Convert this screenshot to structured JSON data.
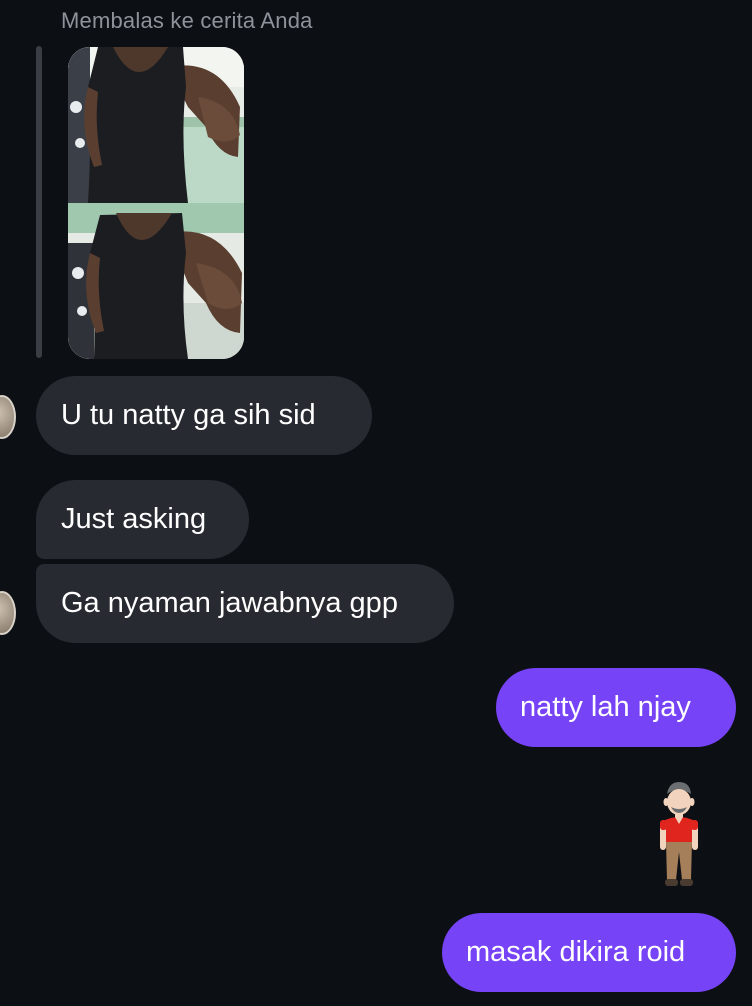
{
  "thread": {
    "reply_context": "Membalas ke cerita Anda",
    "story_image_alt": "Story photo: man in black tank top flexing, two frames"
  },
  "messages": [
    {
      "direction": "incoming",
      "text": "U tu natty ga sih sid"
    },
    {
      "direction": "incoming",
      "text": "Just asking"
    },
    {
      "direction": "incoming",
      "text": "Ga nyaman jawabnya gpp"
    },
    {
      "direction": "outgoing",
      "text": "natty lah njay"
    },
    {
      "direction": "outgoing",
      "emoji": "man-standing-emoji"
    },
    {
      "direction": "outgoing",
      "text": "masak dikira roid"
    }
  ],
  "colors": {
    "background": "#0c0f14",
    "incoming_bubble": "#272a30",
    "outgoing_bubble": "#7743f7",
    "reply_label": "#8e939b"
  }
}
